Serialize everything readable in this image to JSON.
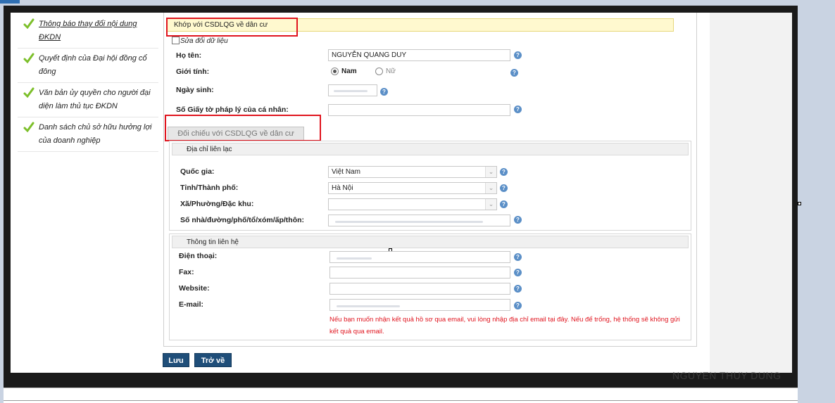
{
  "sidebar": {
    "items": [
      {
        "label": "Thông báo thay đổi nội dung ĐKDN",
        "active": true
      },
      {
        "label": "Quyết định của Đại hội đồng cổ đông"
      },
      {
        "label": "Văn bản ủy quyền cho người đại diện làm thủ tục ĐKDN"
      },
      {
        "label": "Danh sách chủ sở hữu hưởng lợi của doanh nghiệp"
      }
    ]
  },
  "banner": {
    "text": "Khớp với CSDLQG về dân cư"
  },
  "edit_checkbox": {
    "label": "Sửa đổi dữ liệu"
  },
  "personal": {
    "name_label": "Họ tên:",
    "name_value": "NGUYỄN QUANG DUY",
    "gender_label": "Giới tính:",
    "gender_male": "Nam",
    "gender_female": "Nữ",
    "dob_label": "Ngày sinh:",
    "id_label": "Số Giấy tờ pháp lý của cá nhân:"
  },
  "compare_button": {
    "label": "Đối chiếu với CSDLQG về dân cư"
  },
  "address": {
    "title": "Địa chỉ liên lạc",
    "country_label": "Quốc gia:",
    "country_value": "Việt Nam",
    "province_label": "Tỉnh/Thành phố:",
    "province_value": "Hà Nội",
    "ward_label": "Xã/Phường/Đặc khu:",
    "street_label": "Số nhà/đường/phố/tổ/xóm/ấp/thôn:"
  },
  "contact": {
    "title": "Thông tin liên hệ",
    "phone_label": "Điện thoại:",
    "fax_label": "Fax:",
    "website_label": "Website:",
    "email_label": "E-mail:",
    "notice": "Nếu bạn muốn nhận kết quả hồ sơ qua email, vui lòng nhập địa chỉ email tại đây. Nếu để trống, hệ thống sẽ không gửi kết quả qua email."
  },
  "actions": {
    "save": "Lưu",
    "back": "Trở về"
  },
  "watermark": {
    "text": "NGUYEN THUY DUNG"
  },
  "colors": {
    "accent": "#1f4e79",
    "highlight_box": "#e0141e",
    "banner_bg": "#fff9cf",
    "check": "#7cbf2a"
  },
  "icons": {
    "check": "check-icon",
    "help": "help-icon",
    "dropdown": "chevron-down-icon"
  }
}
